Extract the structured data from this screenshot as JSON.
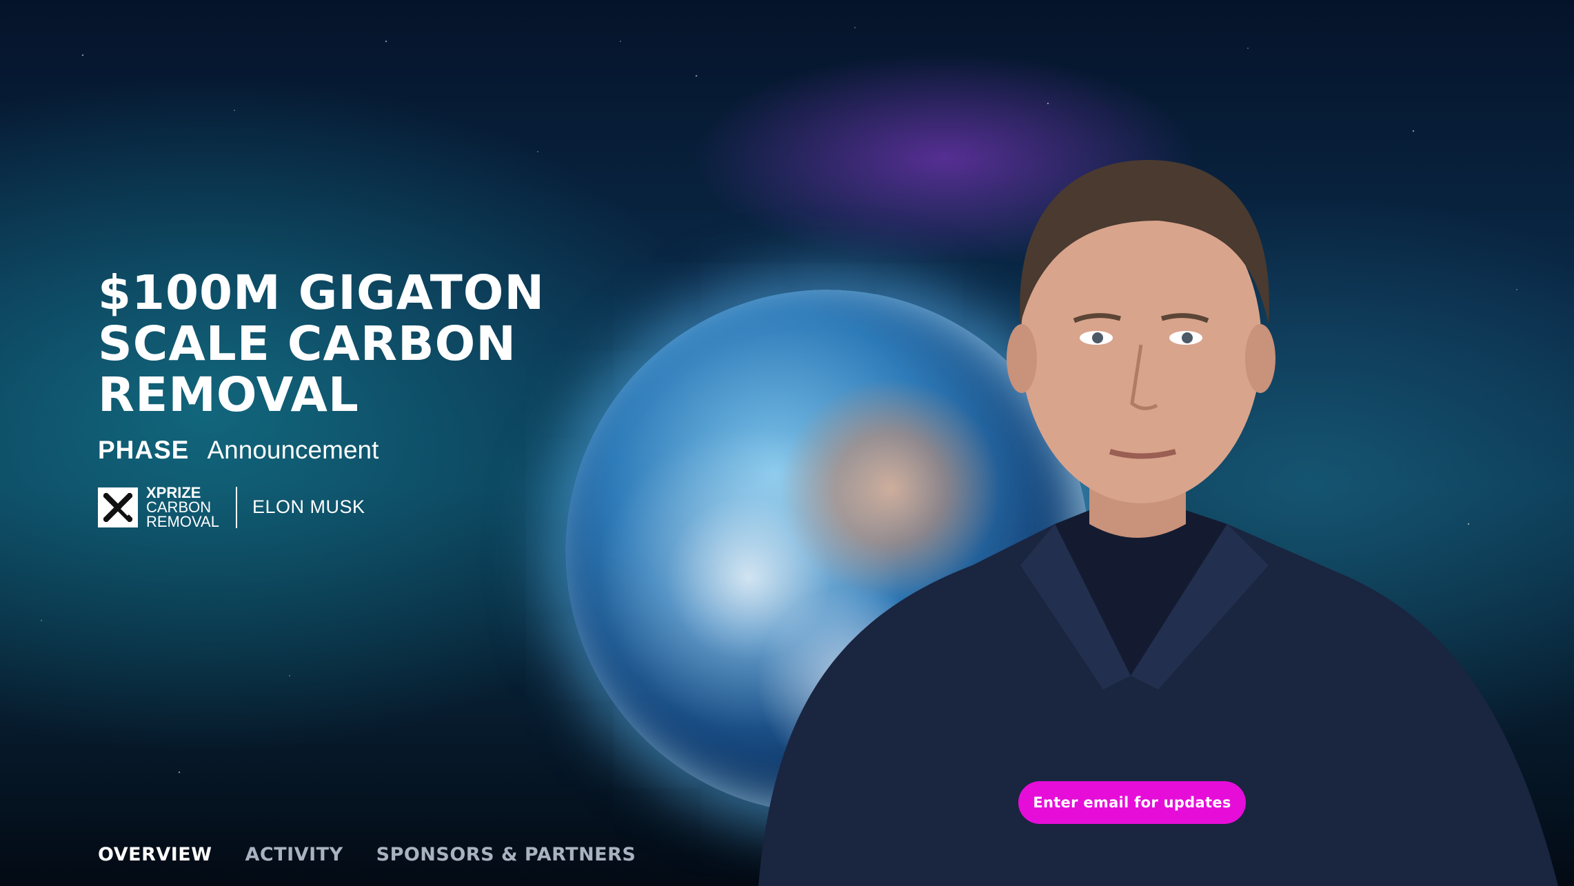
{
  "hero": {
    "title": "$100M GIGATON SCALE CARBON REMOVAL",
    "phase_label": "PHASE",
    "phase_value": "Announcement"
  },
  "brand": {
    "logo_icon": "xprize-x-icon",
    "logo_line1": "XPRIZE",
    "logo_line2": "CARBON",
    "logo_line3": "REMOVAL",
    "sponsor": "ELON MUSK"
  },
  "cta": {
    "label": "Enter email for updates",
    "color": "#e60dd9"
  },
  "tabs": [
    {
      "label": "OVERVIEW",
      "active": true
    },
    {
      "label": "ACTIVITY",
      "active": false
    },
    {
      "label": "SPONSORS & PARTNERS",
      "active": false
    }
  ]
}
